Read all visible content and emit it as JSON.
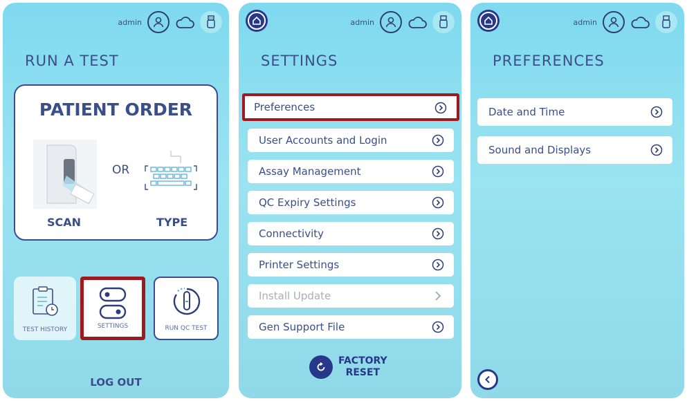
{
  "colors": {
    "accent": "#27378a",
    "text": "#3a4f8a",
    "highlight": "#a0191f",
    "panel_bg": "#8fdcee"
  },
  "panel1": {
    "user": "admin",
    "heading": "RUN A TEST",
    "order_title": "PATIENT ORDER",
    "or_text": "OR",
    "scan_label": "SCAN",
    "type_label": "TYPE",
    "tiles": {
      "history": "TEST HISTORY",
      "settings": "SETTINGS",
      "qc": "RUN QC TEST"
    },
    "logout": "LOG OUT"
  },
  "panel2": {
    "user": "admin",
    "heading": "SETTINGS",
    "items": [
      {
        "label": "Preferences"
      },
      {
        "label": "User Accounts and Login"
      },
      {
        "label": "Assay Management"
      },
      {
        "label": "QC Expiry Settings"
      },
      {
        "label": "Connectivity"
      },
      {
        "label": "Printer Settings"
      },
      {
        "label": "Install Update"
      },
      {
        "label": "Gen Support File"
      }
    ],
    "factory_line1": "FACTORY",
    "factory_line2": "RESET"
  },
  "panel3": {
    "user": "admin",
    "heading": "PREFERENCES",
    "items": [
      {
        "label": "Date and Time"
      },
      {
        "label": "Sound and Displays"
      }
    ]
  },
  "icons": [
    "home-icon",
    "user-icon",
    "cloud-icon",
    "usb-icon",
    "chevron-circle-icon",
    "chevron-right-icon",
    "clipboard-clock-icon",
    "toggle-icon",
    "test-tube-icon",
    "reset-icon",
    "back-icon",
    "scanner-icon",
    "keyboard-icon"
  ]
}
